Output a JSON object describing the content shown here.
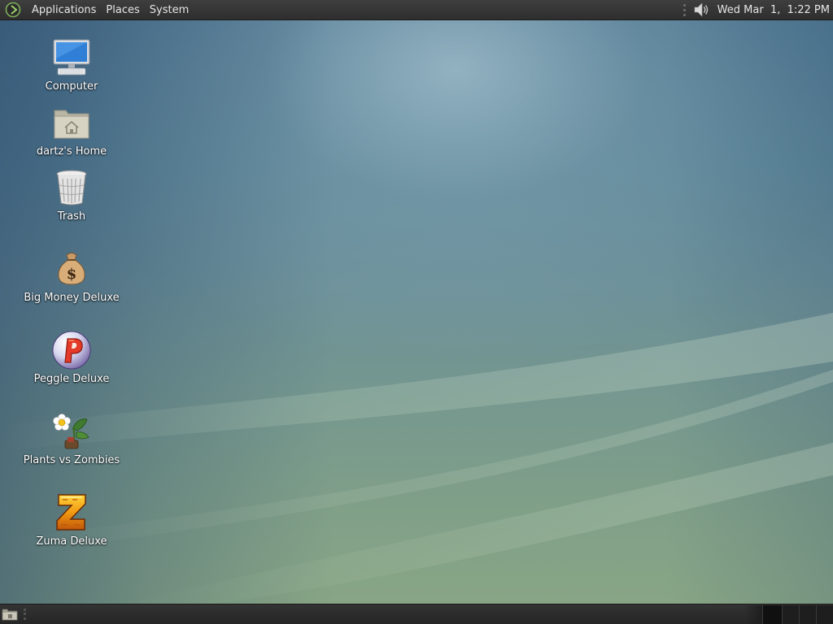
{
  "top_panel": {
    "menus": [
      "Applications",
      "Places",
      "System"
    ],
    "clock": "Wed Mar  1,  1:22 PM",
    "icons": {
      "logo": "distro-logo-icon",
      "volume": "volume-icon"
    }
  },
  "desktop": {
    "icons": [
      {
        "label": "Computer",
        "icon": "computer-icon"
      },
      {
        "label": "dartz's Home",
        "icon": "home-folder-icon"
      },
      {
        "label": "Trash",
        "icon": "trash-icon"
      },
      {
        "label": "Big Money Deluxe",
        "icon": "money-bag-icon"
      },
      {
        "label": "Peggle Deluxe",
        "icon": "peggle-icon"
      },
      {
        "label": "Plants vs Zombies",
        "icon": "plants-vs-zombies-icon"
      },
      {
        "label": "Zuma Deluxe",
        "icon": "zuma-icon"
      }
    ]
  },
  "bottom_panel": {
    "icons": {
      "show_desktop": "show-desktop-icon"
    },
    "workspaces": 4,
    "active_workspace": 1
  },
  "colors": {
    "panel": "#2e2e2e",
    "panel_text": "#e6e6e6",
    "wallpaper_top": "#4d7690",
    "wallpaper_bottom": "#88a585"
  }
}
